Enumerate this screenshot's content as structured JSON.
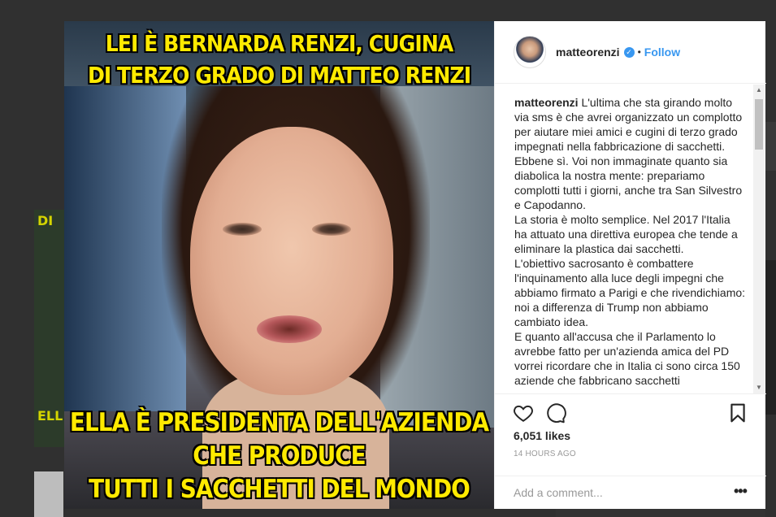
{
  "post": {
    "caption_top": [
      "LEI È BERNARDA RENZI, CUGINA",
      "DI TERZO GRADO DI MATTEO RENZI"
    ],
    "caption_bottom": [
      "ELLA È PRESIDENTA DELL'AZIENDA",
      "CHE PRODUCE",
      "TUTTI I SACCHETTI DEL MONDO"
    ]
  },
  "background": {
    "left_text_top": "DI",
    "left_text_bottom": "ELL"
  },
  "header": {
    "username": "matteorenzi",
    "verified_icon": "verified-badge-icon",
    "separator": "•",
    "follow_label": "Follow"
  },
  "comment": {
    "author": "matteorenzi",
    "text": "L'ultima che sta girando molto via sms è che avrei organizzato un complotto per aiutare miei amici e cugini di terzo grado impegnati nella fabbricazione di sacchetti. Ebbene sì. Voi non immaginate quanto sia diabolica la nostra mente: prepariamo complotti tutti i giorni, anche tra San Silvestro e Capodanno.",
    "paragraph2": "La storia è molto semplice. Nel 2017 l'Italia ha attuato una direttiva europea che tende a eliminare la plastica dai sacchetti.",
    "paragraph3": "L'obiettivo sacrosanto è combattere l'inquinamento alla luce degli impegni che abbiamo firmato a Parigi e che rivendichiamo: noi a differenza di Trump non abbiamo cambiato idea.",
    "paragraph4": "E quanto all'accusa che il Parlamento lo avrebbe fatto per un'azienda amica del PD vorrei ricordare che in Italia ci sono circa 150 aziende che fabbricano sacchetti"
  },
  "actions": {
    "likes": "6,051 likes",
    "timestamp": "14 HOURS AGO"
  },
  "add_comment": {
    "placeholder": "Add a comment...",
    "more_label": "•••"
  },
  "colors": {
    "accent": "#3897f0",
    "caption": "#ffea00"
  }
}
